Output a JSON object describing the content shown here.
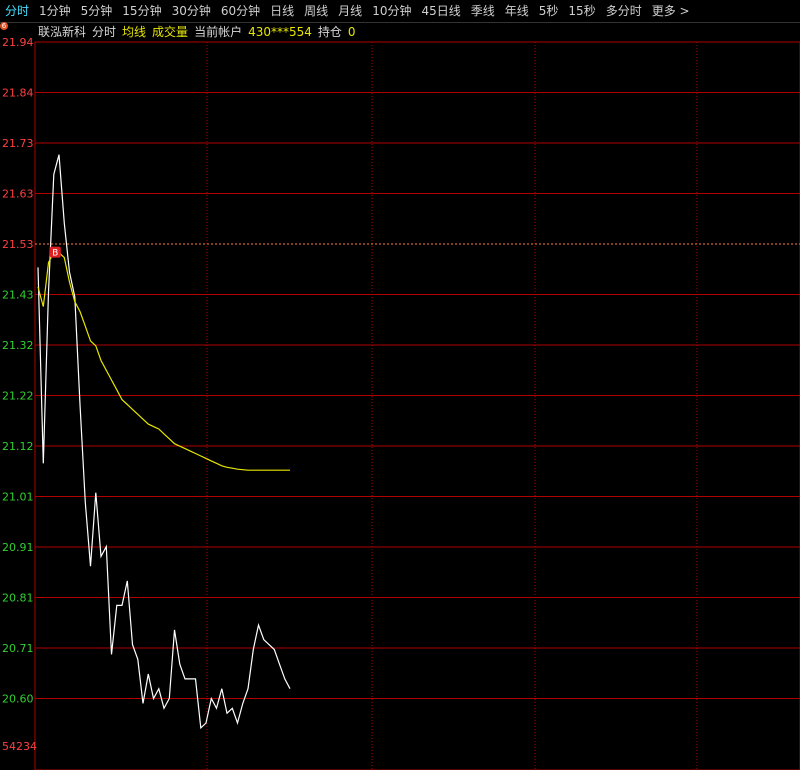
{
  "tabs": [
    {
      "label": "分时",
      "active": true
    },
    {
      "label": "1分钟"
    },
    {
      "label": "5分钟"
    },
    {
      "label": "15分钟"
    },
    {
      "label": "30分钟"
    },
    {
      "label": "60分钟"
    },
    {
      "label": "日线"
    },
    {
      "label": "周线"
    },
    {
      "label": "月线"
    },
    {
      "label": "10分钟"
    },
    {
      "label": "45日线"
    },
    {
      "label": "季线"
    },
    {
      "label": "年线"
    },
    {
      "label": "5秒"
    },
    {
      "label": "15秒"
    },
    {
      "label": "多分时"
    },
    {
      "label": "更多 >"
    }
  ],
  "info": {
    "stock_name": "联泓新科",
    "mode": "分时",
    "avg_line_label": "均线",
    "volume_label": "成交量",
    "account_label": "当前帐户",
    "account_value": "430***554",
    "position_label": "持仓",
    "position_value": "0",
    "bubble_icon": "6"
  },
  "colors": {
    "price_line": "#ffffff",
    "avg_line": "#e6e600",
    "grid": "#b00000",
    "up_label": "#ff4040",
    "down_label": "#30d030",
    "prev_close_line": "#ff8040",
    "buy_marker": "#e02020"
  },
  "chart_data": {
    "type": "line",
    "y_ticks": [
      "21.94",
      "21.84",
      "21.73",
      "21.63",
      "21.53",
      "21.43",
      "21.32",
      "21.22",
      "21.12",
      "21.01",
      "20.91",
      "20.81",
      "20.71",
      "20.60"
    ],
    "prev_close": 21.53,
    "bottom_label": "54234",
    "buy_marker": {
      "label": "B",
      "x_index": 3,
      "price": 21.51
    },
    "x_count": 240,
    "series": [
      {
        "values_x": [
          0,
          1,
          2,
          3,
          4,
          5,
          6,
          7,
          8,
          9,
          10,
          11,
          12,
          13,
          14,
          15,
          16,
          17,
          18,
          19,
          20,
          21,
          22,
          23,
          24,
          25,
          26,
          27,
          28,
          29,
          30,
          31,
          32,
          33,
          34,
          35,
          36,
          37,
          38,
          39,
          40,
          41,
          42,
          43,
          44,
          45,
          46,
          47,
          48,
          49,
          50,
          51,
          52,
          53,
          54,
          55,
          56,
          57,
          58,
          59,
          60,
          61,
          62,
          63,
          64,
          65,
          66,
          67,
          68,
          69,
          70,
          71,
          72,
          73,
          74,
          75,
          76,
          77,
          78,
          79,
          80,
          81,
          82,
          83
        ],
        "values": [
          21.48,
          21.08,
          21.43,
          21.67,
          21.71,
          21.57,
          21.47,
          21.42,
          21.2,
          21.0,
          20.87,
          21.02,
          20.89,
          20.91,
          20.69,
          20.79,
          20.79,
          20.84,
          20.71,
          20.68,
          20.59,
          20.65,
          20.6,
          20.62,
          20.58,
          20.6,
          20.74,
          20.67,
          20.64,
          20.64,
          20.64,
          20.54,
          20.55,
          20.6,
          20.58,
          20.62,
          20.57,
          20.58,
          20.55,
          20.59,
          20.62,
          20.7,
          20.75,
          20.72,
          20.71,
          20.7,
          20.67,
          20.64,
          20.62,
          null
        ]
      },
      {
        "values_x": [
          0,
          1,
          2,
          3,
          4,
          5,
          6,
          7,
          8,
          9,
          10,
          11,
          12,
          13,
          14,
          15,
          16,
          17,
          18,
          19,
          20,
          21,
          22,
          23,
          24,
          25,
          26,
          27,
          28,
          29,
          30,
          31,
          32,
          33,
          34,
          35,
          36,
          37,
          38,
          39,
          40,
          41,
          42,
          43,
          44,
          45,
          46,
          47,
          48,
          49
        ],
        "values": [
          21.44,
          21.4,
          21.49,
          21.51,
          21.51,
          21.5,
          21.45,
          21.41,
          21.39,
          21.36,
          21.33,
          21.32,
          21.29,
          21.27,
          21.25,
          21.23,
          21.21,
          21.2,
          21.19,
          21.18,
          21.17,
          21.16,
          21.155,
          21.15,
          21.14,
          21.13,
          21.12,
          21.115,
          21.11,
          21.105,
          21.1,
          21.095,
          21.09,
          21.085,
          21.08,
          21.075,
          21.072,
          21.07,
          21.068,
          21.067,
          21.066,
          21.066,
          21.066,
          21.066,
          21.066,
          21.066,
          21.066,
          21.066,
          21.066,
          null
        ]
      }
    ]
  }
}
